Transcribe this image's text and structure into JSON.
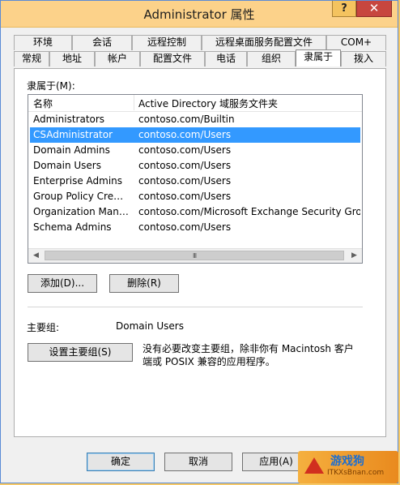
{
  "window": {
    "title": "Administrator 属性",
    "help_glyph": "?",
    "close_glyph": "✕"
  },
  "tabs": {
    "row_top": [
      "环境",
      "会话",
      "远程控制",
      "远程桌面服务配置文件",
      "COM+"
    ],
    "row_bottom": [
      "常规",
      "地址",
      "帐户",
      "配置文件",
      "电话",
      "组织",
      "隶属于",
      "拨入"
    ],
    "active": "隶属于"
  },
  "member_of": {
    "label": "隶属于(M):",
    "columns": [
      "名称",
      "Active Directory 域服务文件夹"
    ],
    "rows": [
      {
        "name": "Administrators",
        "folder": "contoso.com/Builtin"
      },
      {
        "name": "CSAdministrator",
        "folder": "contoso.com/Users",
        "selected": true
      },
      {
        "name": "Domain Admins",
        "folder": "contoso.com/Users"
      },
      {
        "name": "Domain Users",
        "folder": "contoso.com/Users"
      },
      {
        "name": "Enterprise Admins",
        "folder": "contoso.com/Users"
      },
      {
        "name": "Group Policy Creat...",
        "folder": "contoso.com/Users"
      },
      {
        "name": "Organization Mana...",
        "folder": "contoso.com/Microsoft Exchange Security Grou"
      },
      {
        "name": "Schema Admins",
        "folder": "contoso.com/Users"
      }
    ],
    "scroll_left": "◀",
    "scroll_right": "▶",
    "scroll_grip": "III",
    "add_button": "添加(D)...",
    "remove_button": "删除(R)"
  },
  "primary_group": {
    "label": "主要组:",
    "value": "Domain Users",
    "set_button": "设置主要组(S)",
    "note": "没有必要改变主要组，除非你有 Macintosh 客户端或 POSIX 兼容的应用程序。"
  },
  "footer": {
    "ok": "确定",
    "cancel": "取消",
    "apply": "应用(A)"
  },
  "watermark": {
    "line1": "游戏狗",
    "line2": "ITKXsBnan.com"
  }
}
